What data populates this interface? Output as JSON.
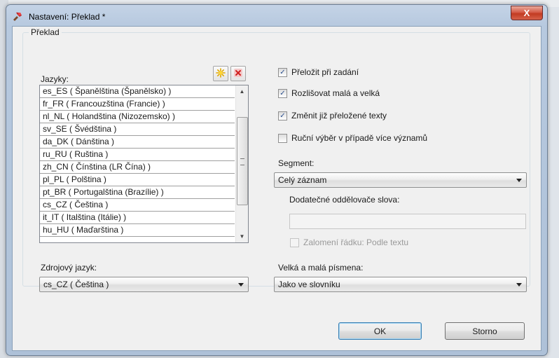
{
  "window": {
    "title": "Nastavení: Překlad *",
    "close_symbol": "X",
    "icons": {
      "app": "app-tool-icon",
      "close": "close-icon"
    }
  },
  "group": {
    "label": "Překlad"
  },
  "languages": {
    "label": "Jazyky:",
    "add_icon": "add-star-icon",
    "remove_icon": "remove-x-icon",
    "items": [
      "es_ES ( Španělština (Španělsko) )",
      "fr_FR ( Francouzština (Francie) )",
      "nl_NL ( Holandština (Nizozemsko) )",
      "sv_SE ( Švédština )",
      "da_DK ( Dánština )",
      "ru_RU ( Ruština )",
      "zh_CN ( Čínština (LR Čína) )",
      "pl_PL ( Polština )",
      "pt_BR ( Portugalština (Brazílie) )",
      "cs_CZ ( Čeština )",
      "it_IT ( Italština (Itálie) )",
      "hu_HU ( Maďarština )"
    ]
  },
  "source_language": {
    "label": "Zdrojový jazyk:",
    "value": "cs_CZ ( Čeština )"
  },
  "options": {
    "translate_on_entry": {
      "label": "Přeložit při zadání",
      "checked": true
    },
    "case_sensitive": {
      "label": "Rozlišovat malá a velká",
      "checked": true
    },
    "change_translated": {
      "label": "Změnit již přeložené texty",
      "checked": true
    },
    "manual_choice": {
      "label": "Ruční výběr v případě více významů",
      "checked": false
    }
  },
  "segment": {
    "label": "Segment:",
    "value": "Celý záznam"
  },
  "separators": {
    "label": "Dodatečné oddělovače slova:",
    "value": ""
  },
  "line_break": {
    "label": "Zalomení řádku: Podle textu",
    "checked": false,
    "enabled": false
  },
  "case": {
    "label": "Velká a malá písmena:",
    "value": "Jako ve slovníku"
  },
  "buttons": {
    "ok": "OK",
    "cancel": "Storno"
  },
  "check_mark": "✓"
}
